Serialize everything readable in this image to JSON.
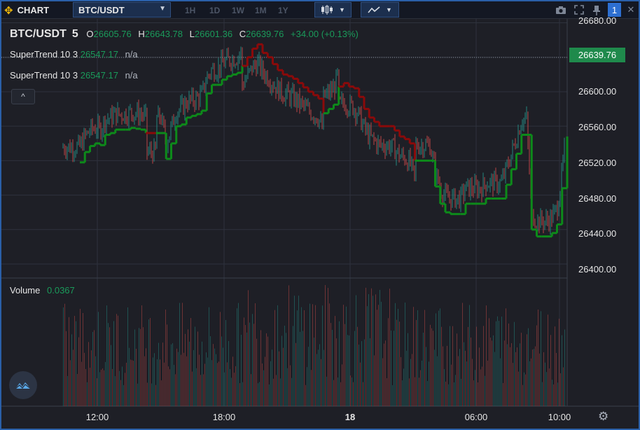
{
  "toolbar": {
    "chart_label": "CHART",
    "move_icon": "move-arrows-icon",
    "symbol": "BTC/USDT",
    "intervals": [
      "1H",
      "1D",
      "1W",
      "1M",
      "1Y"
    ],
    "candle_icon": "candles-icon",
    "indicator_icon": "indicators-icon",
    "camera_icon": "camera-icon",
    "fullscreen_icon": "fullscreen-icon",
    "pin_icon": "pin-icon",
    "counter": "1"
  },
  "header": {
    "symbol": "BTC/USDT",
    "interval": "5",
    "open_key": "O",
    "open": "26605.76",
    "high_key": "H",
    "high": "26643.78",
    "low_key": "L",
    "low": "26601.36",
    "close_key": "C",
    "close": "26639.76",
    "change": "+34.00 (+0.13%)"
  },
  "indicators": [
    {
      "label": "SuperTrend 10 3",
      "value": "26547.17",
      "extra": "n/a"
    },
    {
      "label": "SuperTrend 10 3",
      "value": "26547.17",
      "extra": "n/a"
    }
  ],
  "collapse_label": "^",
  "last_price": "26639.76",
  "volume": {
    "label": "Volume",
    "value": "0.0367"
  },
  "y_axis": {
    "ticks": [
      "26680.00",
      "26640.00",
      "26600.00",
      "26560.00",
      "26520.00",
      "26480.00",
      "26440.00",
      "26400.00"
    ],
    "range": [
      26393.5,
      26684.5
    ]
  },
  "x_axis": {
    "ticks": [
      "12:00",
      "18:00",
      "18",
      "06:00",
      "10:00"
    ]
  },
  "colors": {
    "up": "#26a69a",
    "down": "#ef5350",
    "supertrend_up": "#0d8a1a",
    "supertrend_down": "#8b0a0a",
    "price_tag": "#1f8a4c",
    "background": "#1e1f26"
  },
  "chart_data": {
    "type": "line",
    "title": "BTC/USDT 5",
    "xlabel": "",
    "ylabel": "",
    "x_ticks": [
      "12:00",
      "18:00",
      "18",
      "06:00",
      "10:00"
    ],
    "ylim": [
      26400,
      26680
    ],
    "series": [
      {
        "name": "SuperTrend 10 3",
        "values": [
          26518,
          26530,
          26537,
          26540,
          26538,
          26550,
          26552,
          26556,
          26556,
          26556,
          26558,
          26557,
          26556,
          26552,
          26552,
          26552,
          26552,
          26522,
          26540,
          26560,
          26562,
          26570,
          26572,
          26574,
          26578,
          26598,
          26608,
          26608,
          26614,
          26618,
          26620,
          26622,
          26630,
          26640,
          26650,
          26655,
          26645,
          26640,
          26632,
          26625,
          26620,
          26618,
          26615,
          26610,
          26605,
          26600,
          26596,
          26592,
          26575,
          26580,
          26585,
          26606,
          26610,
          26606,
          26604,
          26594,
          26580,
          26570,
          26565,
          26560,
          26560,
          26560,
          26555,
          26548,
          26545,
          26540,
          26520,
          26520,
          26520,
          26520,
          26490,
          26470,
          26460,
          26458,
          26458,
          26458,
          26470,
          26470,
          26470,
          26470,
          26476,
          26476,
          26476,
          26476,
          26492,
          26510,
          26528,
          26550,
          26550,
          26440,
          26432,
          26432,
          26432,
          26436,
          26446,
          26488,
          26548
        ],
        "trend": [
          "up",
          "up",
          "up",
          "up",
          "up",
          "up",
          "up",
          "up",
          "up",
          "up",
          "up",
          "up",
          "up",
          "down",
          "down",
          "up",
          "up",
          "up",
          "up",
          "up",
          "up",
          "up",
          "up",
          "up",
          "up",
          "up",
          "up",
          "up",
          "up",
          "up",
          "up",
          "up",
          "down",
          "down",
          "down",
          "down",
          "down",
          "down",
          "down",
          "down",
          "down",
          "down",
          "down",
          "down",
          "down",
          "down",
          "down",
          "down",
          "up",
          "up",
          "up",
          "down",
          "down",
          "down",
          "down",
          "down",
          "down",
          "down",
          "down",
          "down",
          "down",
          "down",
          "down",
          "down",
          "down",
          "down",
          "up",
          "up",
          "up",
          "up",
          "up",
          "up",
          "up",
          "up",
          "up",
          "up",
          "up",
          "up",
          "up",
          "up",
          "up",
          "up",
          "up",
          "up",
          "up",
          "up",
          "up",
          "up",
          "up",
          "up",
          "up",
          "up",
          "up",
          "up",
          "up",
          "up",
          "up"
        ]
      }
    ],
    "volume_scale": [
      0,
      0.0367
    ]
  }
}
